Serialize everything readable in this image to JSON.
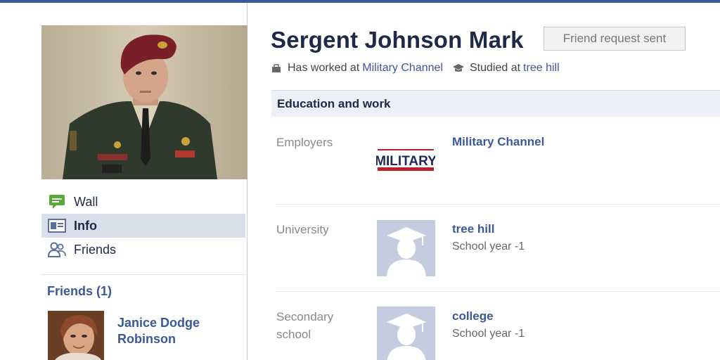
{
  "colors": {
    "facebook_blue": "#3b5998",
    "nav_active_bg": "#d8dfea",
    "section_bg": "#eceff5",
    "placeholder_bg": "#c4cde0"
  },
  "sidebar": {
    "nav_items": [
      {
        "label": "Wall",
        "icon": "wall-speech-bubble-icon",
        "active": false
      },
      {
        "label": "Info",
        "icon": "info-card-icon",
        "active": true
      },
      {
        "label": "Friends",
        "icon": "friends-people-icon",
        "active": false
      }
    ],
    "friends_title": "Friends (1)",
    "friend": {
      "name": "Janice Dodge Robinson"
    }
  },
  "profile": {
    "name": "Sergent Johnson Mark",
    "friend_request_label": "Friend request sent",
    "worked_prefix": "Has worked at ",
    "worked_link": "Military Channel",
    "studied_prefix": "Studied at ",
    "studied_link": "tree hill"
  },
  "education_work": {
    "header": "Education and work",
    "employers_label": "Employers",
    "employer": {
      "name": "Military Channel",
      "logo_text": "MILITARY"
    },
    "university_label": "University",
    "university": {
      "name": "tree hill",
      "detail": "School year -1"
    },
    "secondary_label_line1": "Secondary",
    "secondary_label_line2": "school",
    "secondary": {
      "name": "college",
      "detail": "School year -1"
    }
  }
}
